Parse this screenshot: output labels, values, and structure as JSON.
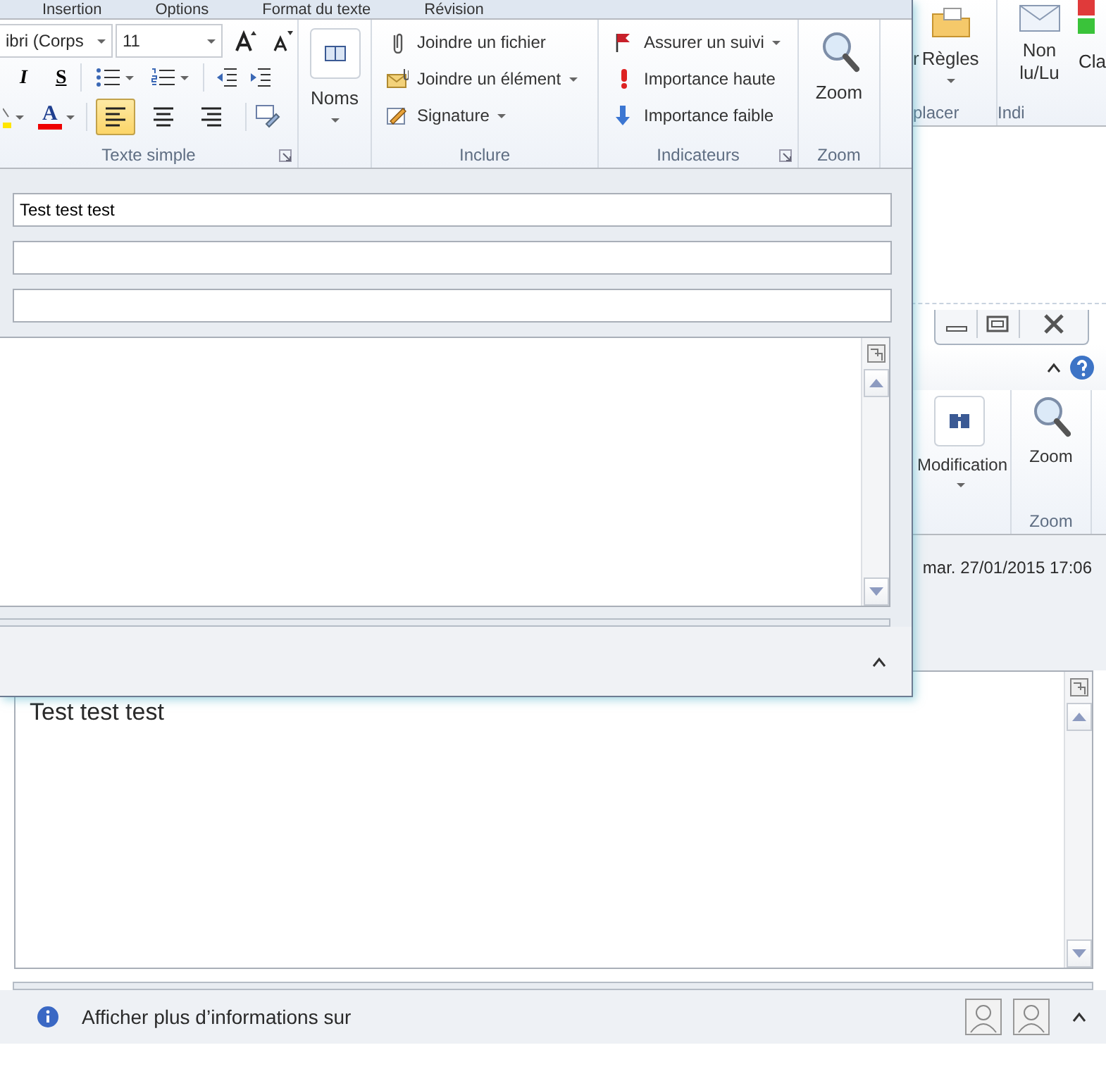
{
  "compose_window": {
    "tabs": [
      {
        "label": "Insertion",
        "selected": false
      },
      {
        "label": "Options",
        "selected": false
      },
      {
        "label": "Format du texte",
        "selected": false
      },
      {
        "label": "Révision",
        "selected": false
      }
    ],
    "ribbon": {
      "basic_text": {
        "label": "Texte simple",
        "font_name": "ibri (Corps",
        "font_size": "11",
        "italic_label": "I",
        "underline_label": "S",
        "font_color_label": "A",
        "align": [
          {
            "selected": true
          },
          {
            "selected": false
          },
          {
            "selected": false
          }
        ]
      },
      "names": {
        "label": "Noms"
      },
      "include": {
        "label": "Inclure",
        "items": [
          {
            "label": "Joindre un fichier",
            "dropdown": false
          },
          {
            "label": "Joindre un élément",
            "dropdown": true
          },
          {
            "label": "Signature",
            "dropdown": true
          }
        ]
      },
      "flags": {
        "label": "Indicateurs",
        "items": [
          {
            "label": "Assurer un suivi",
            "dropdown": true
          },
          {
            "label": "Importance haute",
            "dropdown": false
          },
          {
            "label": "Importance faible",
            "dropdown": false
          }
        ]
      },
      "zoom": {
        "label": "Zoom",
        "button": "Zoom"
      }
    },
    "fields": [
      {
        "kind": "filled",
        "value": "Test test test"
      },
      {
        "kind": "blank"
      },
      {
        "kind": "blank"
      }
    ]
  },
  "main_window": {
    "ribbon": {
      "move_group": {
        "label": "placer",
        "cut_button": "r",
        "rules_button": "Règles"
      },
      "tags_group": {
        "label": "Indi",
        "read_button": "Non lu/Lu",
        "cut_button": "Cla"
      }
    },
    "reading_window": {
      "edit_button": "Modification",
      "zoom_group": {
        "label": "Zoom",
        "button": "Zoom"
      },
      "date": "mar. 27/01/2015 17:06",
      "body": "Test test test"
    },
    "people_pane": {
      "text": "Afficher plus d’informations sur"
    }
  }
}
